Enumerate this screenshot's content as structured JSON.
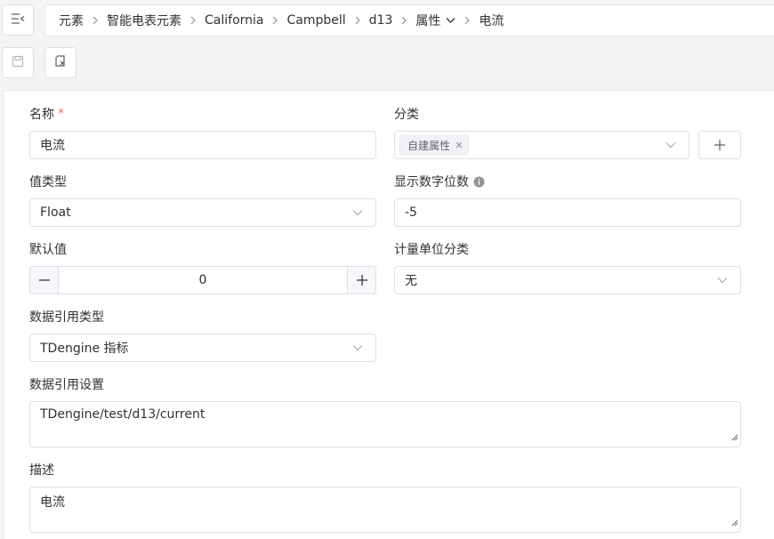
{
  "breadcrumb": [
    "元素",
    "智能电表元素",
    "California",
    "Campbell",
    "d13",
    "属性",
    "电流"
  ],
  "icons": {
    "menu": "menu-fold-icon",
    "save": "save-icon",
    "discard": "discard-changes-icon",
    "separator": "chevron-right-icon",
    "dropdown": "chevron-down-icon",
    "info": "info-circle-icon",
    "plus": "plus-icon",
    "minus": "minus-icon",
    "tag_close": "close-icon"
  },
  "colors": {
    "required": "#f56c6c",
    "border": "#dcdfe6",
    "page_bg": "#f4f4f5"
  },
  "form": {
    "name": {
      "label": "名称",
      "required_mark": "*",
      "value": "电流"
    },
    "category": {
      "label": "分类",
      "tags": [
        "自建属性"
      ]
    },
    "value_type": {
      "label": "值类型",
      "value": "Float"
    },
    "display_digits": {
      "label": "显示数字位数",
      "value": "-5"
    },
    "default_value": {
      "label": "默认值",
      "value": "0"
    },
    "uom_category": {
      "label": "计量单位分类",
      "value": "无"
    },
    "data_ref_type": {
      "label": "数据引用类型",
      "value": "TDengine 指标"
    },
    "data_ref_settings": {
      "label": "数据引用设置",
      "value": "TDengine/test/d13/current"
    },
    "description": {
      "label": "描述",
      "value": "电流"
    }
  }
}
